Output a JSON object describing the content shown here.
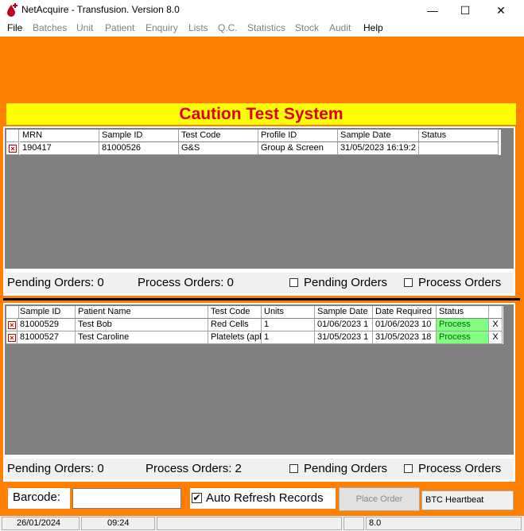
{
  "window": {
    "title": "NetAcquire - Transfusion. Version 8.0",
    "minimize": "—",
    "maximize": "☐",
    "close": "✕"
  },
  "menu": [
    {
      "label": "File",
      "enabled": true
    },
    {
      "label": "Batches",
      "enabled": false
    },
    {
      "label": "Unit",
      "enabled": false
    },
    {
      "label": "Patient",
      "enabled": false
    },
    {
      "label": "Enquiry",
      "enabled": false
    },
    {
      "label": "Lists",
      "enabled": false
    },
    {
      "label": "Q.C.",
      "enabled": false
    },
    {
      "label": "Statistics",
      "enabled": false
    },
    {
      "label": "Stock",
      "enabled": false
    },
    {
      "label": "Audit",
      "enabled": false
    },
    {
      "label": "Help",
      "enabled": true
    }
  ],
  "banner": "Caution Test System",
  "top_grid": {
    "columns": [
      "MRN",
      "Sample ID",
      "Test Code",
      "Profile ID",
      "Sample Date",
      "Status"
    ],
    "rows": [
      [
        "190417",
        "81000526",
        "G&S",
        "Group & Screen",
        "31/05/2023 16:19:2",
        ""
      ]
    ],
    "footer": {
      "pending": "Pending Orders: 0",
      "process": "Process Orders: 0",
      "pending_check": "Pending Orders",
      "process_check": "Process Orders"
    }
  },
  "bottom_grid": {
    "columns": [
      "Sample ID",
      "Patient Name",
      "Test Code",
      "Units",
      "Sample Date",
      "Date Required",
      "Status",
      ""
    ],
    "rows": [
      [
        "81000529",
        "Test Bob",
        "Red Cells",
        "1",
        "01/06/2023 1",
        "01/06/2023 10",
        "Process",
        "X"
      ],
      [
        "81000527",
        "Test Caroline",
        "Platelets (aph",
        "1",
        "31/05/2023 1",
        "31/05/2023 18",
        "Process",
        "X"
      ]
    ],
    "footer": {
      "pending": "Pending Orders: 0",
      "process": "Process Orders: 2",
      "pending_check": "Pending Orders",
      "process_check": "Process Orders"
    }
  },
  "controls": {
    "barcode_label": "Barcode:",
    "barcode_value": "",
    "auto_refresh_label": "Auto Refresh Records",
    "auto_refresh_checked": "✔",
    "place_order": "Place Order",
    "btc_heartbeat": "BTC Heartbeat"
  },
  "statusbar": {
    "date": "26/01/2024",
    "time": "09:24",
    "version": "8.0"
  },
  "colors": {
    "background": "#ff8000",
    "banner_bg": "#ffff00",
    "banner_text": "#e0001b",
    "status_process": "#80ff80"
  }
}
